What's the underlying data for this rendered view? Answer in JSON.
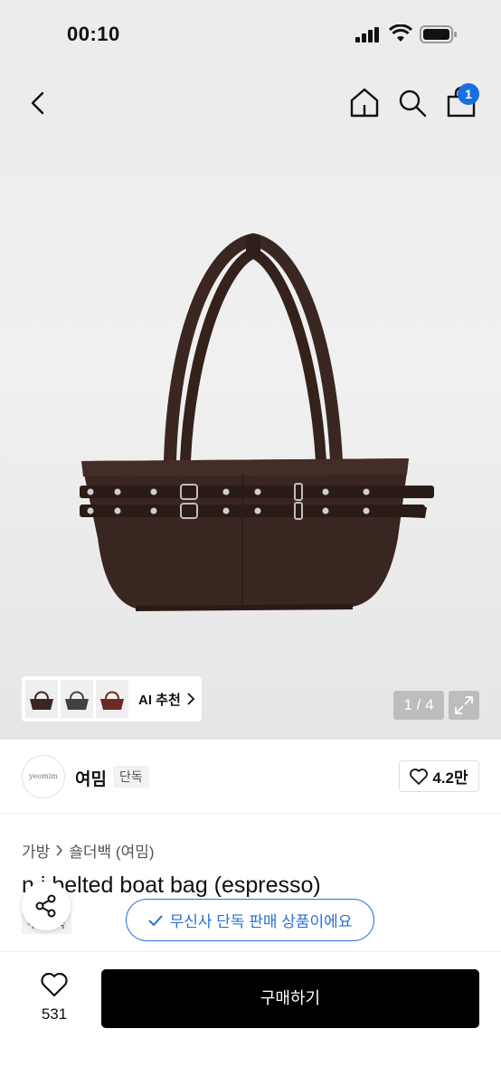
{
  "status_bar": {
    "time": "00:10"
  },
  "nav": {
    "cart_count": "1"
  },
  "gallery": {
    "pager": "1 / 4",
    "ai_label": "AI 추천"
  },
  "brand": {
    "logo_text": "yeomim",
    "name": "여밈",
    "tag": "단독",
    "likes": "4.2만"
  },
  "product": {
    "category": "가방",
    "subcategory": "숄더백 (여밈)",
    "title": "mini belted boat bag (espresso)",
    "title_visible": "n  i belted boat bag (espresso)",
    "tag": "무신사 단독",
    "tag_visible": "무  단독"
  },
  "exclusive_banner": "무신사 단독 판매 상품이에요",
  "bottom": {
    "wish_count": "531",
    "buy_label": "구매하기"
  },
  "colors": {
    "accent": "#2b6fd6",
    "badge": "#1a6fe0",
    "buy": "#000000",
    "bag": "#3a2620"
  }
}
